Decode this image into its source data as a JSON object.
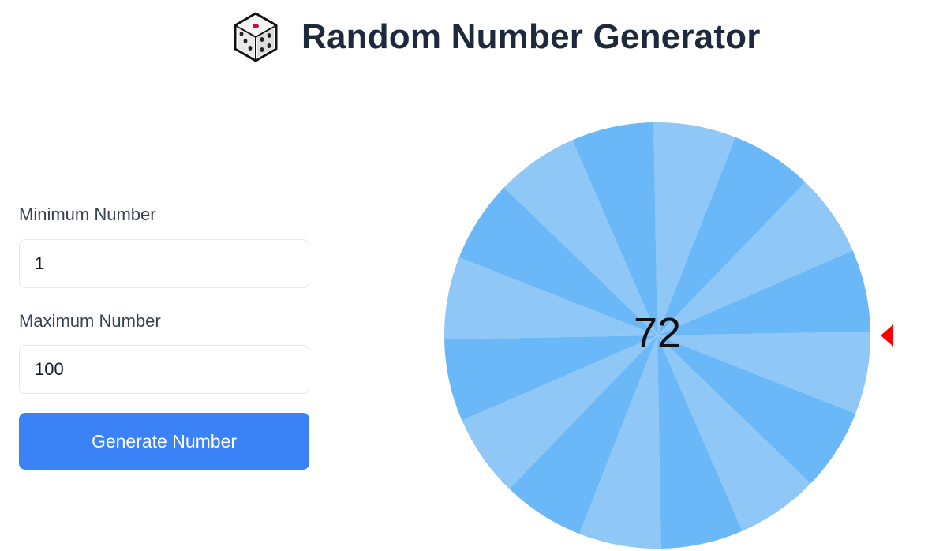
{
  "header": {
    "icon": "dice-icon",
    "title": "Random Number Generator"
  },
  "form": {
    "min_label": "Minimum Number",
    "min_value": "1",
    "max_label": "Maximum Number",
    "max_value": "100",
    "generate_label": "Generate Number"
  },
  "wheel": {
    "segment_count": 16,
    "colors": [
      "#6ab8f7",
      "#8fc7f6"
    ],
    "result": "72",
    "pointer_icon": "pointer-arrow-icon",
    "pointer_color": "#ff0000"
  },
  "colors": {
    "accent": "#3b82f6",
    "title": "#1e293b"
  }
}
